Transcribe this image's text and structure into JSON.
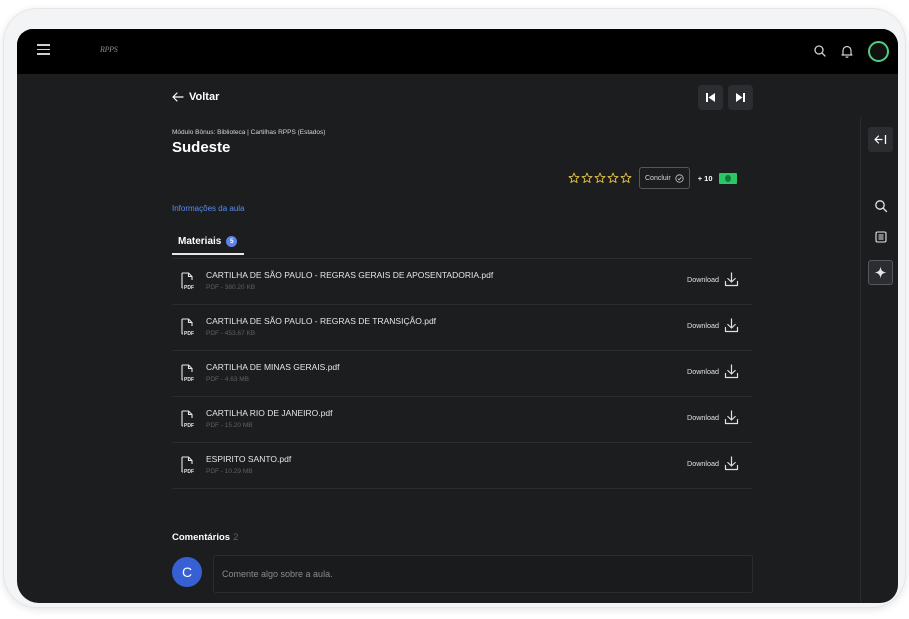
{
  "app": {
    "logo_text": "RPPS"
  },
  "topbar": {
    "menu_icon": "hamburger-icon",
    "search_icon": "search-icon",
    "bell_icon": "bell-icon",
    "avatar_ring_color": "#4cd080"
  },
  "lesson": {
    "back_label": "Voltar",
    "breadcrumb": "Módulo Bônus: Biblioteca | Cartilhas RPPS (Estados)",
    "title": "Sudeste",
    "rating_stars": 5,
    "rating_value": 0,
    "complete_label": "Concluir",
    "xp_label": "+ 10",
    "info_link": "Informações da aula"
  },
  "tabs": {
    "materials_label": "Materiais",
    "materials_count": "5"
  },
  "files": [
    {
      "name": "CARTILHA DE SÃO PAULO - REGRAS GERAIS DE APOSENTADORIA.pdf",
      "meta": "PDF - 380.20 KB",
      "download_label": "Download"
    },
    {
      "name": "CARTILHA DE SÃO PAULO - REGRAS DE TRANSIÇÃO.pdf",
      "meta": "PDF - 453.67 KB",
      "download_label": "Download"
    },
    {
      "name": "CARTILHA DE MINAS GERAIS.pdf",
      "meta": "PDF - 4.63 MB",
      "download_label": "Download"
    },
    {
      "name": "CARTILHA RIO DE JANEIRO.pdf",
      "meta": "PDF - 15.20 MB",
      "download_label": "Download"
    },
    {
      "name": "ESPIRITO SANTO.pdf",
      "meta": "PDF - 10.29 MB",
      "download_label": "Download"
    }
  ],
  "file_icon_label": "PDF",
  "comments": {
    "title": "Comentários",
    "count": "2",
    "avatar_initial": "C",
    "placeholder": "Comente algo sobre a aula."
  },
  "colors": {
    "accent_blue": "#5b83f0",
    "link_blue": "#5a8df0",
    "money_green": "#29c864",
    "star_yellow": "#e8c547"
  }
}
